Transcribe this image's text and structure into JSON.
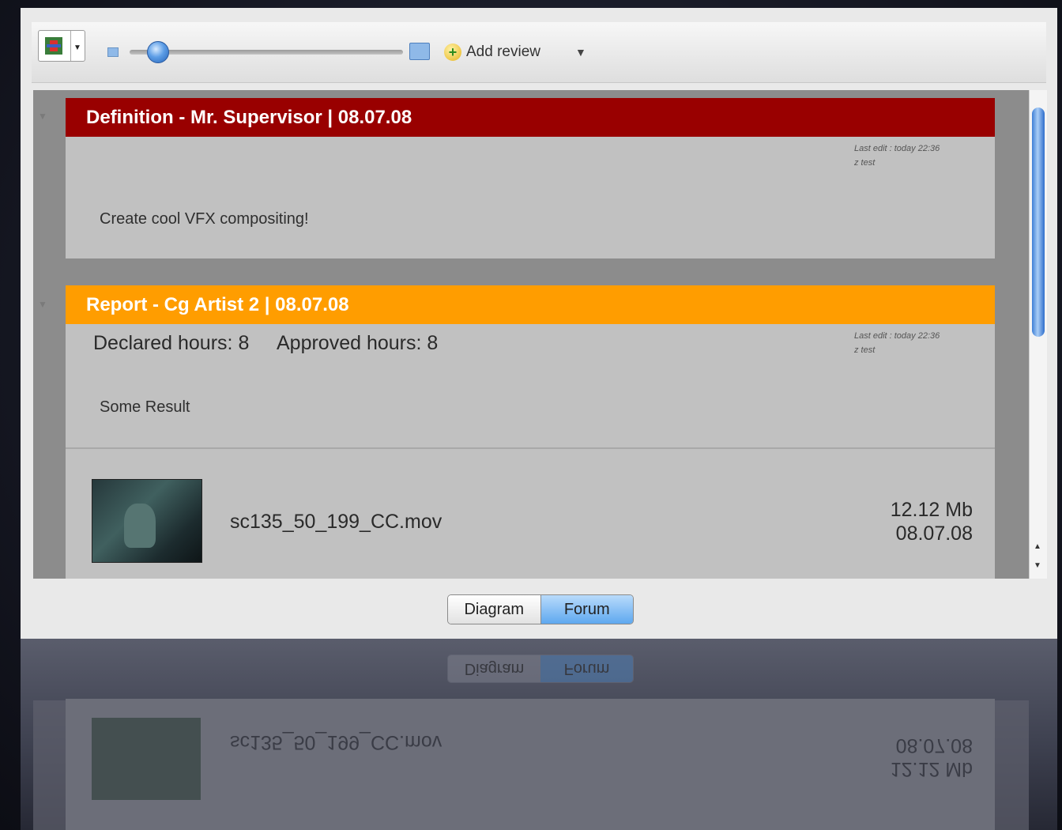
{
  "toolbar": {
    "add_review_label": "Add review",
    "dropdown_glyph": "▼",
    "icons": [
      "icon-picker",
      "small-thumbnail-icon",
      "large-thumbnail-icon",
      "add-review-icon"
    ]
  },
  "definition_card": {
    "header": "Definition - Mr. Supervisor | 08.07.08",
    "header_color": "#990000",
    "last_edit": "Last edit : today 22:36",
    "last_edit_user": "z test",
    "text": "Create cool VFX compositing!"
  },
  "report_card": {
    "header": "Report - Cg Artist 2 | 08.07.08",
    "header_color": "#ff9d00",
    "declared_hours_label": "Declared hours:",
    "declared_hours": "8",
    "approved_hours_label": "Approved hours:",
    "approved_hours": "8",
    "last_edit": "Last edit : today 22:36",
    "last_edit_user": "z test",
    "text": "Some Result"
  },
  "attachment": {
    "filename": "sc135_50_199_CC.mov",
    "size": "12.12 Mb",
    "date": "08.07.08"
  },
  "view_switch": {
    "options": [
      "Diagram",
      "Forum"
    ],
    "selected": "Forum"
  }
}
